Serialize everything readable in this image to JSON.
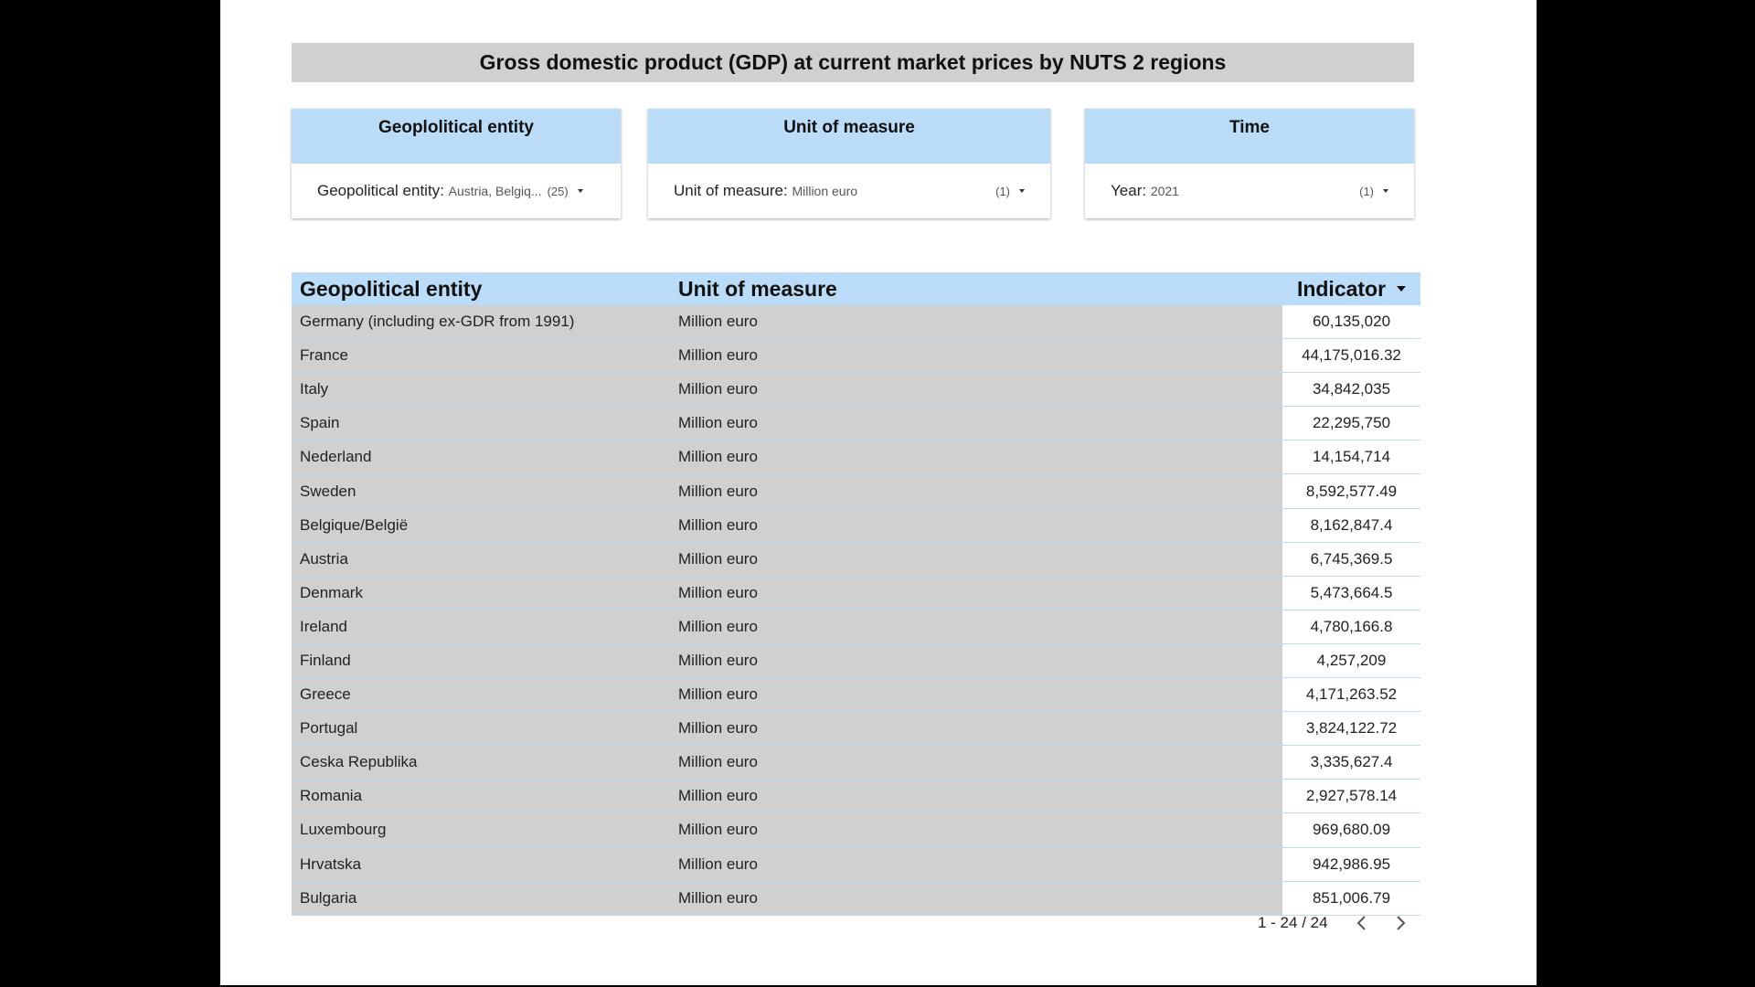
{
  "title": "Gross domestic product (GDP) at current market prices by NUTS 2 regions",
  "filters": {
    "geo": {
      "header": "Geoplolitical entity",
      "label": "Geopolitical entity",
      "value": "Austria, Belgiq...",
      "count": "(25)",
      "icon": "dropdown-caret-icon"
    },
    "unit": {
      "header": "Unit of measure",
      "label": "Unit of measure",
      "value": "Million euro",
      "count": "(1)",
      "icon": "dropdown-caret-icon"
    },
    "time": {
      "header": "Time",
      "label": "Year",
      "value": "2021",
      "count": "(1)",
      "icon": "dropdown-caret-icon"
    }
  },
  "table": {
    "columns": [
      "Geopolitical entity",
      "Unit of measure",
      "Indicator"
    ],
    "sort_icon": "sort-caret-down-icon",
    "rows": [
      {
        "entity": "Germany (including ex-GDR from 1991)",
        "unit": "Million euro",
        "indicator": "60,135,020"
      },
      {
        "entity": "France",
        "unit": "Million euro",
        "indicator": "44,175,016.32"
      },
      {
        "entity": "Italy",
        "unit": "Million euro",
        "indicator": "34,842,035"
      },
      {
        "entity": "Spain",
        "unit": "Million euro",
        "indicator": "22,295,750"
      },
      {
        "entity": "Nederland",
        "unit": "Million euro",
        "indicator": "14,154,714"
      },
      {
        "entity": "Sweden",
        "unit": "Million euro",
        "indicator": "8,592,577.49"
      },
      {
        "entity": "Belgique/België",
        "unit": "Million euro",
        "indicator": "8,162,847.4"
      },
      {
        "entity": "Austria",
        "unit": "Million euro",
        "indicator": "6,745,369.5"
      },
      {
        "entity": "Denmark",
        "unit": "Million euro",
        "indicator": "5,473,664.5"
      },
      {
        "entity": "Ireland",
        "unit": "Million euro",
        "indicator": "4,780,166.8"
      },
      {
        "entity": "Finland",
        "unit": "Million euro",
        "indicator": "4,257,209"
      },
      {
        "entity": "Greece",
        "unit": "Million euro",
        "indicator": "4,171,263.52"
      },
      {
        "entity": "Portugal",
        "unit": "Million euro",
        "indicator": "3,824,122.72"
      },
      {
        "entity": "Ceska Republika",
        "unit": "Million euro",
        "indicator": "3,335,627.4"
      },
      {
        "entity": "Romania",
        "unit": "Million euro",
        "indicator": "2,927,578.14"
      },
      {
        "entity": "Luxembourg",
        "unit": "Million euro",
        "indicator": "969,680.09"
      },
      {
        "entity": "Hrvatska",
        "unit": "Million euro",
        "indicator": "942,986.95"
      },
      {
        "entity": "Bulgaria",
        "unit": "Million euro",
        "indicator": "851,006.79"
      }
    ]
  },
  "pager": {
    "range": "1 - 24 / 24",
    "prev_icon": "chevron-left-icon",
    "next_icon": "chevron-right-icon"
  }
}
